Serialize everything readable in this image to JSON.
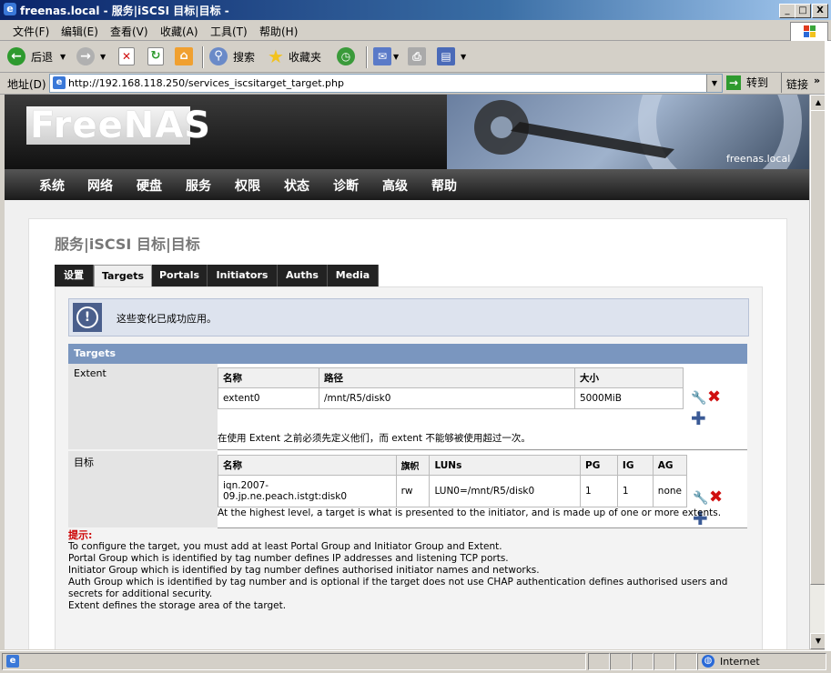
{
  "window": {
    "title": "freenas.local - 服务|iSCSI 目标|目标 -",
    "btn_min": "_",
    "btn_max": "□",
    "btn_close": "X"
  },
  "menubar": [
    "文件(F)",
    "编辑(E)",
    "查看(V)",
    "收藏(A)",
    "工具(T)",
    "帮助(H)"
  ],
  "toolbar": {
    "back": "后退",
    "search": "搜索",
    "favorites": "收藏夹"
  },
  "addressbar": {
    "label": "地址(D)",
    "url": "http://192.168.118.250/services_iscsitarget_target.php",
    "go": "转到",
    "links": "链接"
  },
  "header": {
    "logo": "FreeNAS",
    "hostname": "freenas.local"
  },
  "nav": [
    "系统",
    "网络",
    "硬盘",
    "服务",
    "权限",
    "状态",
    "诊断",
    "高级",
    "帮助"
  ],
  "page": {
    "title": "服务|iSCSI 目标|目标"
  },
  "tabs": [
    {
      "label": "设置",
      "active": false
    },
    {
      "label": "Targets",
      "active": true
    },
    {
      "label": "Portals",
      "active": false
    },
    {
      "label": "Initiators",
      "active": false
    },
    {
      "label": "Auths",
      "active": false
    },
    {
      "label": "Media",
      "active": false
    }
  ],
  "message": "这些变化已成功应用。",
  "section": "Targets",
  "extent": {
    "label": "Extent",
    "headers": [
      "名称",
      "路径",
      "大小"
    ],
    "row": [
      "extent0",
      "/mnt/R5/disk0",
      "5000MiB"
    ],
    "note": "在使用 Extent 之前必须先定义他们，而 extent 不能够被使用超过一次。"
  },
  "target": {
    "label": "目标",
    "headers": [
      "名称",
      "旗帜",
      "LUNs",
      "PG",
      "IG",
      "AG"
    ],
    "row": [
      "iqn.2007-09.jp.ne.peach.istgt:disk0",
      "rw",
      "LUN0=/mnt/R5/disk0",
      "1",
      "1",
      "none"
    ],
    "note": "At the highest level, a target is what is presented to the initiator, and is made up of one or more extents."
  },
  "hint": {
    "title": "提示:",
    "lines": [
      "To configure the target, you must add at least Portal Group and Initiator Group and Extent.",
      "Portal Group which is identified by tag number defines IP addresses and listening TCP ports.",
      "Initiator Group which is identified by tag number defines authorised initiator names and networks.",
      "Auth Group which is identified by tag number and is optional if the target does not use CHAP authentication defines authorised users and secrets for additional security.",
      "Extent defines the storage area of the target."
    ]
  },
  "statusbar": {
    "zone": "Internet"
  }
}
